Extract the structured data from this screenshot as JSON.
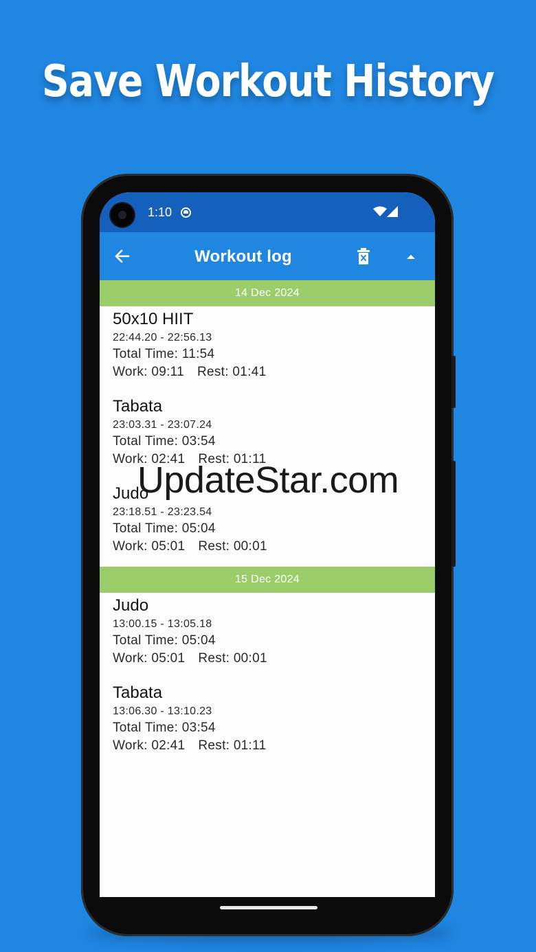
{
  "headline": "Save Workout History",
  "status_bar": {
    "time": "1:10"
  },
  "app_bar": {
    "title": "Workout log",
    "back_icon": "arrow-left-icon",
    "delete_icon": "trash-x-icon",
    "collapse_icon": "caret-up-icon"
  },
  "sections": [
    {
      "date": "14 Dec 2024",
      "entries": [
        {
          "name": "50x10 HIIT",
          "range": "22:44.20 - 22:56.13",
          "total": "Total Time: 11:54",
          "work": "Work: 09:11",
          "rest": "Rest: 01:41"
        },
        {
          "name": "Tabata",
          "range": "23:03.31 - 23:07.24",
          "total": "Total Time: 03:54",
          "work": "Work: 02:41",
          "rest": "Rest: 01:11"
        },
        {
          "name": "Judo",
          "range": "23:18.51 - 23:23.54",
          "total": "Total Time: 05:04",
          "work": "Work: 05:01",
          "rest": "Rest: 00:01"
        }
      ]
    },
    {
      "date": "15 Dec 2024",
      "entries": [
        {
          "name": "Judo",
          "range": "13:00.15 - 13:05.18",
          "total": "Total Time: 05:04",
          "work": "Work: 05:01",
          "rest": "Rest: 00:01"
        },
        {
          "name": "Tabata",
          "range": "13:06.30 - 13:10.23",
          "total": "Total Time: 03:54",
          "work": "Work: 02:41",
          "rest": "Rest: 01:11"
        }
      ]
    }
  ],
  "watermark": "UpdateStar.com",
  "colors": {
    "background": "#1f86e2",
    "status_bar": "#1560bd",
    "app_bar": "#1f86e2",
    "date_header": "#9bce6a"
  }
}
